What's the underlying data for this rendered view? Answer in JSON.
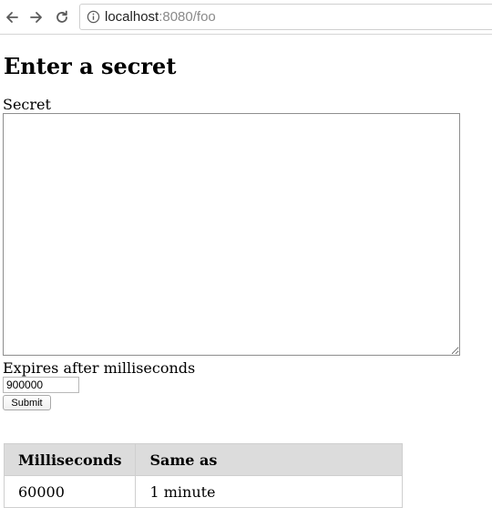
{
  "browser": {
    "address_host": "localhost",
    "address_path": ":8080/foo"
  },
  "page": {
    "title": "Enter a secret",
    "secret_label": "Secret",
    "secret_value": "",
    "expires_label": "Expires after milliseconds",
    "expires_value": "900000",
    "submit_label": "Submit"
  },
  "table": {
    "headers": [
      "Milliseconds",
      "Same as"
    ],
    "rows": [
      [
        "60000",
        "1 minute"
      ]
    ]
  },
  "icons": {
    "back": "arrow-left-icon",
    "forward": "arrow-right-icon",
    "reload": "reload-icon",
    "info": "info-icon"
  }
}
